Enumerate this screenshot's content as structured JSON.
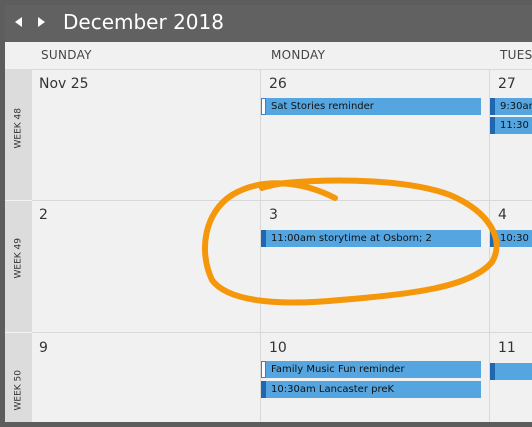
{
  "header": {
    "month_title": "December 2018"
  },
  "day_headers": [
    "SUNDAY",
    "MONDAY",
    "TUESDAY"
  ],
  "weeks": [
    {
      "label": "WEEK 48",
      "sunday": {
        "day": "Nov 25"
      },
      "monday": {
        "day": "26",
        "events": [
          {
            "text": "Sat Stories reminder",
            "kind": "reminder"
          }
        ]
      },
      "tuesday": {
        "day": "27",
        "events": [
          {
            "text": "9:30am"
          },
          {
            "text": "11:30"
          }
        ]
      }
    },
    {
      "label": "WEEK 49",
      "sunday": {
        "day": "2"
      },
      "monday": {
        "day": "3",
        "events": [
          {
            "text": "11:00am storytime at Osborn; 2"
          }
        ]
      },
      "tuesday": {
        "day": "4",
        "events": [
          {
            "text": "10:30"
          }
        ]
      }
    },
    {
      "label": "WEEK 50",
      "sunday": {
        "day": "9"
      },
      "monday": {
        "day": "10",
        "events": [
          {
            "text": "Family Music Fun reminder",
            "kind": "reminder"
          },
          {
            "text": "10:30am Lancaster preK"
          }
        ]
      },
      "tuesday": {
        "day": "11",
        "events": [
          {
            "text": ""
          }
        ]
      }
    }
  ],
  "colors": {
    "event": "#55a6e0",
    "annotation": "#f5970a",
    "header": "#616161"
  },
  "icons": {
    "prev": "left-arrow-icon",
    "next": "right-arrow-icon"
  }
}
